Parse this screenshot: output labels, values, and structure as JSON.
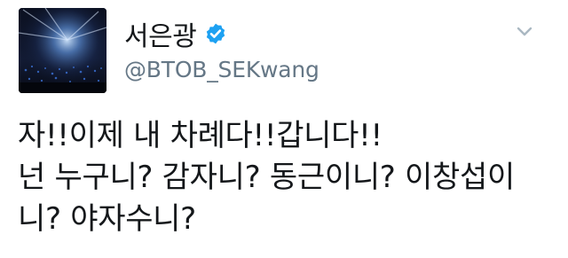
{
  "tweet": {
    "display_name": "서은광",
    "handle": "@BTOB_SEKwang",
    "verified": true,
    "lines": [
      "자!!이제 내 차례다!!갑니다!!",
      "넌 누구니? 감자니? 동근이니? 이창섭이",
      "니? 야자수니?"
    ]
  },
  "icons": {
    "verified": "verified-badge-icon",
    "menu": "chevron-down-icon",
    "avatar": "concert-stage-photo"
  },
  "colors": {
    "verified_blue": "#1da1f2",
    "handle_gray": "#657786",
    "text": "#14171a",
    "caret_gray": "#aab8c2"
  }
}
